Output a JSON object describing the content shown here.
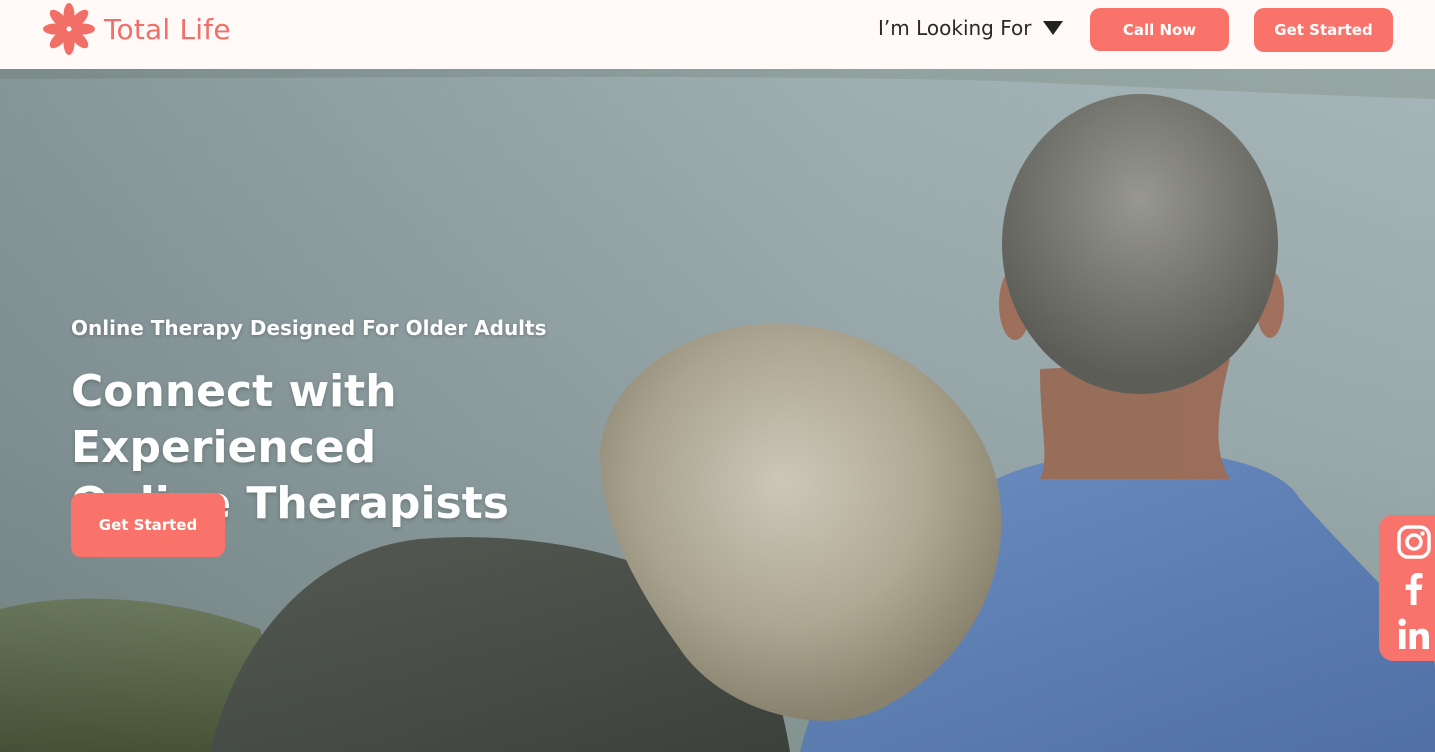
{
  "header": {
    "brand": "Total Life",
    "brand_color": "#f26f68",
    "nav_looking_for": "I’m Looking For",
    "call_now": "Call Now",
    "get_started": "Get Started"
  },
  "hero": {
    "subtitle": "Online Therapy Designed For Older Adults",
    "title_line1": "Connect with Experienced",
    "title_line2": "Online Therapists",
    "cta": "Get Started",
    "accent": "#fa736b"
  },
  "social": {
    "icons": [
      "instagram-icon",
      "facebook-icon",
      "linkedin-icon"
    ]
  }
}
